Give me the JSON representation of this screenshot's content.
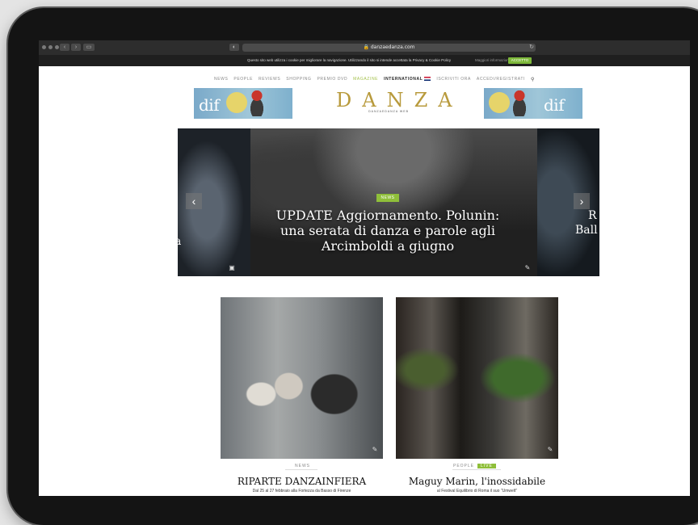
{
  "browser": {
    "url": "danzaedanza.com",
    "lock_icon": "lock-icon"
  },
  "cookie_bar": {
    "text": "Questo sito web utilizza i cookie per migliorare la navigazione. Utilizzando il sito si intende accettata la Privacy & Cookie Policy",
    "more_label": "Maggiori informazioni",
    "accept_label": "ACCETTO"
  },
  "nav": {
    "items": [
      "NEWS",
      "PEOPLE",
      "REVIEWS",
      "SHOPPING",
      "PREMIO DVD",
      "MAGAZINE",
      "INTERNATIONAL",
      "ISCRIVITI ORA",
      "ACCEDI/REGISTRATI"
    ]
  },
  "ads": {
    "left_text": "dif",
    "right_text": "dif"
  },
  "logo": {
    "word": "DANZA",
    "sub": "DANZAEDANZA WEB"
  },
  "hero": {
    "badge": "NEWS",
    "title": "UPDATE Aggiornamento. Polunin: una serata di danza e parole agli Arcimboldi a giugno",
    "left_fragment": "a",
    "right_fragment_1": "R",
    "right_fragment_2": "Ball",
    "prev_arrow": "‹",
    "next_arrow": "›"
  },
  "cards": [
    {
      "tag": "NEWS",
      "title": "RIPARTE DANZAINFIERA",
      "subtitle": "Dal 25 al 27 febbraio alla Fortezza da Basso di Firenze"
    },
    {
      "tag": "PEOPLE",
      "tag_badge": "LIVE",
      "title": "Maguy Marin, l'inossidabile",
      "subtitle": "al Festival Equilibrio di Roma il suo \"Umwelt\""
    }
  ],
  "colors": {
    "accent_green": "#8fbf3a",
    "logo_gold": "#b89a3c",
    "dark": "#141414"
  }
}
